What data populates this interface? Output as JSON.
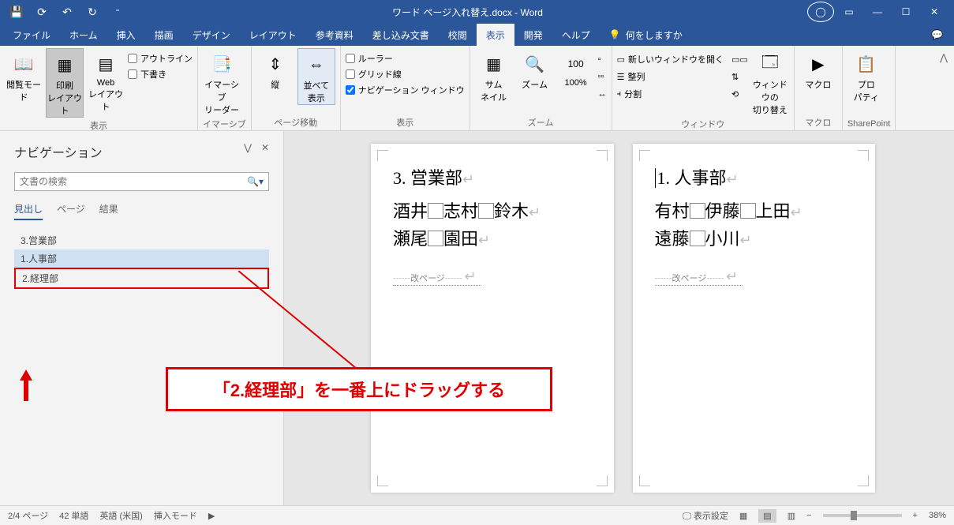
{
  "title": "ワード ページ入れ替え.docx - Word",
  "tabs": [
    "ファイル",
    "ホーム",
    "挿入",
    "描画",
    "デザイン",
    "レイアウト",
    "参考資料",
    "差し込み文書",
    "校閲",
    "表示",
    "開発",
    "ヘルプ"
  ],
  "active_tab_index": 9,
  "tellme": "何をしますか",
  "ribbon": {
    "g1": {
      "label": "表示",
      "items": [
        "閲覧モード",
        "印刷\nレイアウト",
        "Web\nレイアウト"
      ],
      "chk": [
        "アウトライン",
        "下書き"
      ]
    },
    "g2": {
      "label": "イマーシブ",
      "item": "イマーシブ\nリーダー"
    },
    "g3": {
      "label": "ページ移動",
      "items": [
        "縦",
        "並べて\n表示"
      ]
    },
    "g4": {
      "label": "表示",
      "chk": [
        {
          "l": "ルーラー",
          "c": false
        },
        {
          "l": "グリッド線",
          "c": false
        },
        {
          "l": "ナビゲーション ウィンドウ",
          "c": true
        }
      ]
    },
    "g5": {
      "label": "ズーム",
      "items": [
        "サム\nネイル",
        "ズーム",
        "100%"
      ]
    },
    "g6": {
      "label": "ウィンドウ",
      "rows": [
        "新しいウィンドウを開く",
        "整列",
        "分割"
      ],
      "item": "ウィンドウの\n切り替え"
    },
    "g7": {
      "label": "マクロ",
      "item": "マクロ"
    },
    "g8": {
      "label": "SharePoint",
      "item": "プロ\nパティ"
    }
  },
  "nav": {
    "title": "ナビゲーション",
    "search_placeholder": "文書の検索",
    "tabs": [
      "見出し",
      "ページ",
      "結果"
    ],
    "items": [
      "3.営業部",
      "1.人事部",
      "2.経理部"
    ]
  },
  "pages": [
    {
      "heading": "3. 営業部",
      "lines": [
        [
          "酒井",
          "志村",
          "鈴木"
        ],
        [
          "瀬尾",
          "園田"
        ]
      ],
      "break": "改ページ"
    },
    {
      "heading": "1. 人事部",
      "lines": [
        [
          "有村",
          "伊藤",
          "上田"
        ],
        [
          "遠藤",
          "小川"
        ]
      ],
      "break": "改ページ"
    }
  ],
  "callout": "「2.経理部」を一番上にドラッグする",
  "status": {
    "page": "2/4 ページ",
    "words": "42 単語",
    "lang": "英語 (米国)",
    "mode": "挿入モード",
    "display": "表示設定",
    "zoom": "38%"
  }
}
